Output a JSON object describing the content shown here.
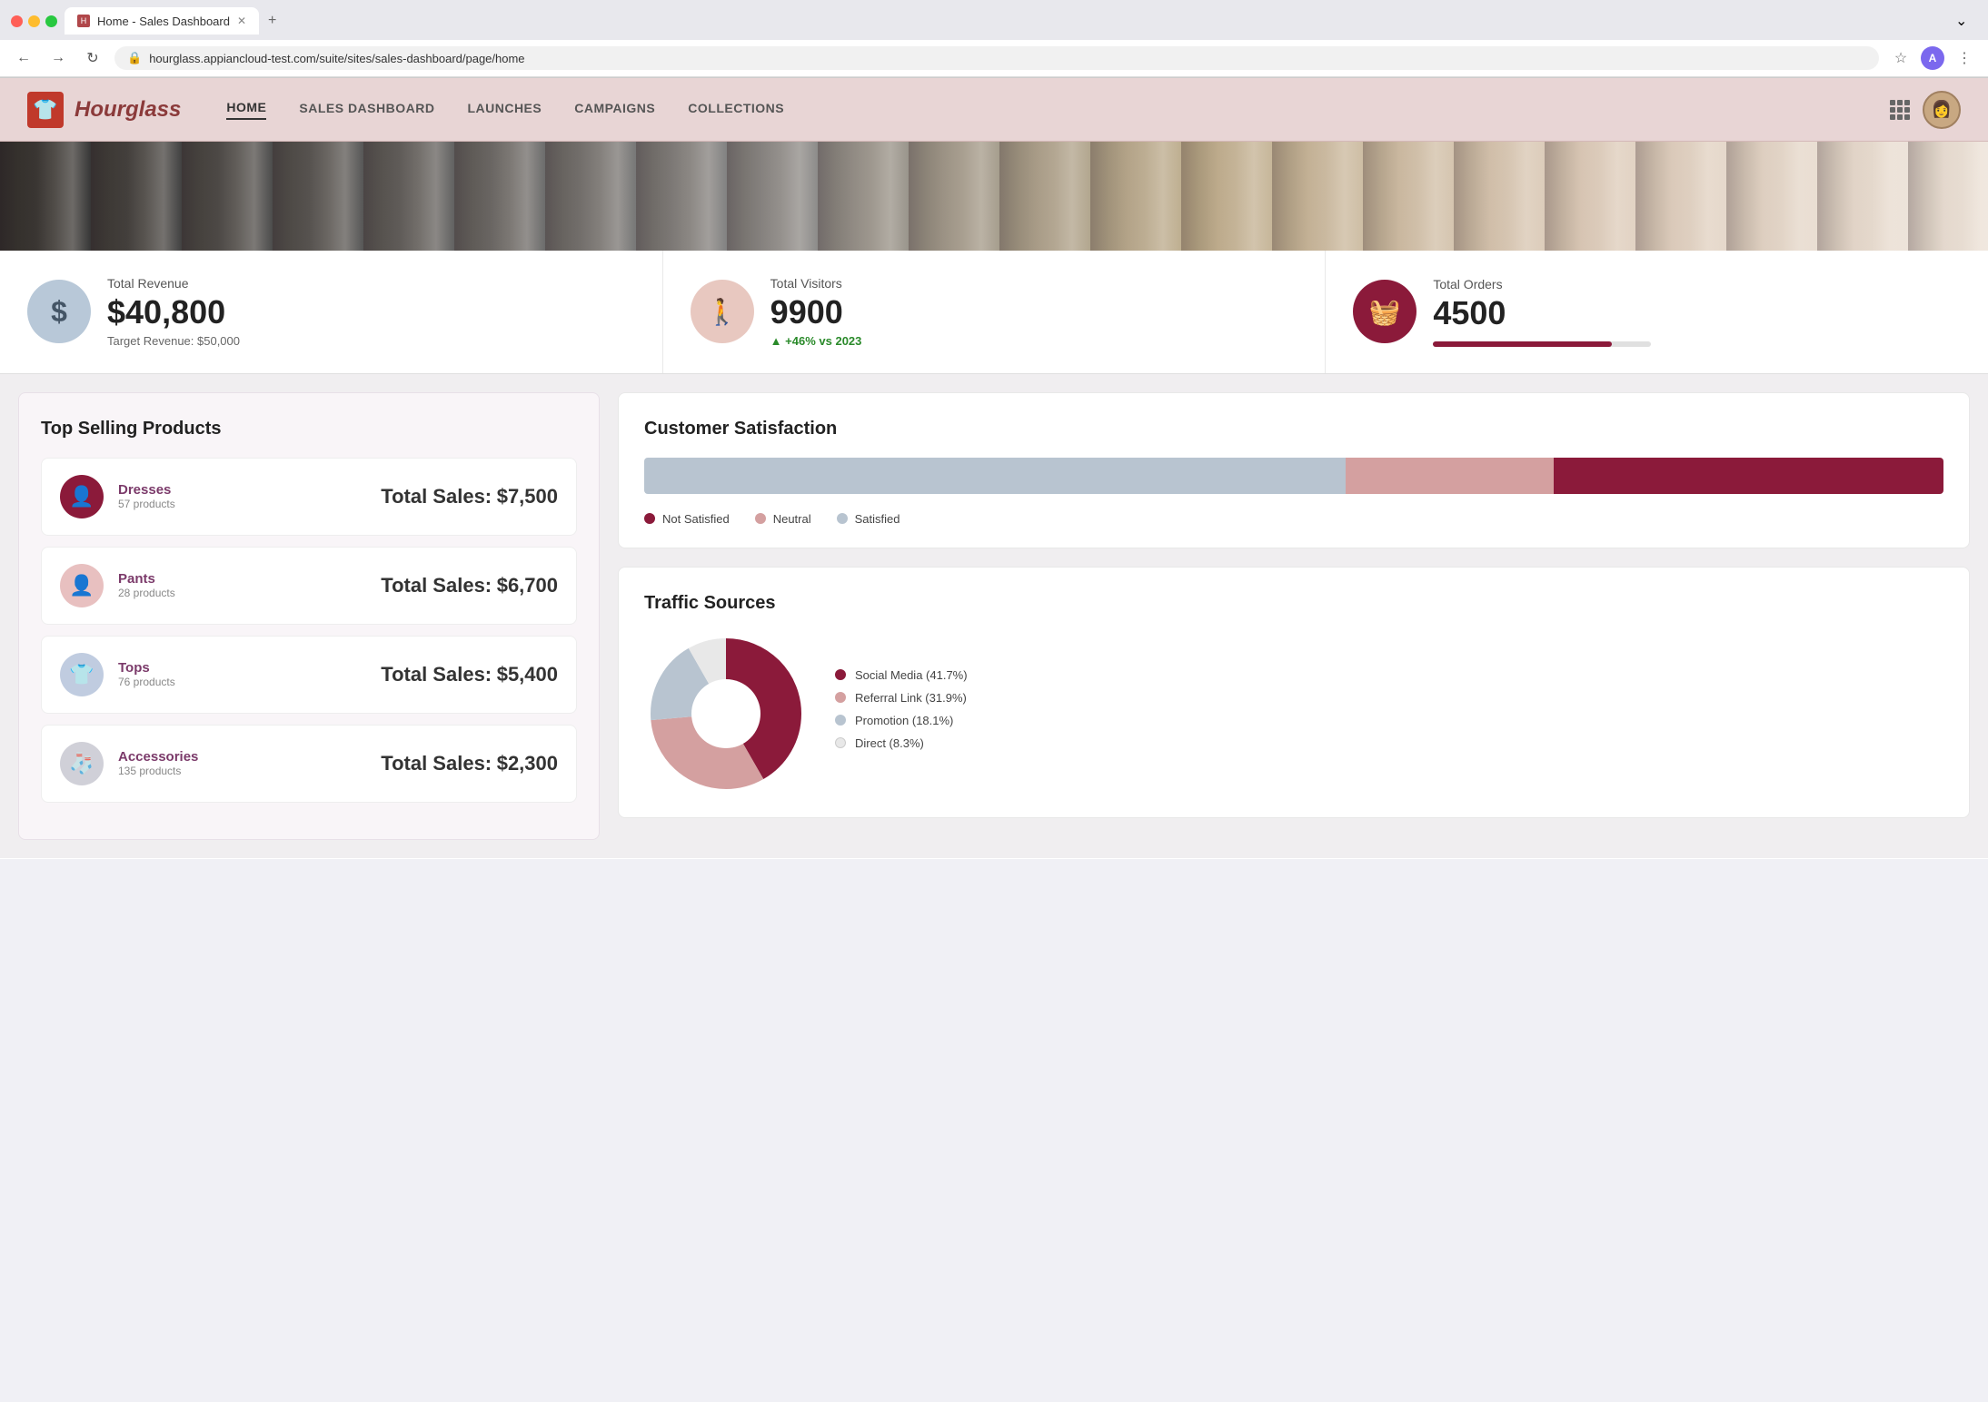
{
  "browser": {
    "tab_title": "Home - Sales Dashboard",
    "favicon_text": "H",
    "new_tab_icon": "+",
    "nav": {
      "back": "←",
      "forward": "→",
      "reload": "↻",
      "url": "hourglass.appiancloud-test.com/suite/sites/sales-dashboard/page/home",
      "bookmark": "☆",
      "profile_letter": "A",
      "more": "⋮"
    }
  },
  "app": {
    "brand_icon": "👕",
    "brand_name": "Hourglass",
    "nav_links": [
      {
        "label": "HOME",
        "active": true
      },
      {
        "label": "SALES DASHBOARD",
        "active": false
      },
      {
        "label": "LAUNCHES",
        "active": false
      },
      {
        "label": "CAMPAIGNS",
        "active": false
      },
      {
        "label": "COLLECTIONS",
        "active": false
      }
    ]
  },
  "stats": [
    {
      "icon": "$",
      "icon_class": "stat-icon-blue",
      "label": "Total Revenue",
      "value": "$40,800",
      "sub": "Target Revenue: $50,000",
      "sub_class": "",
      "show_progress": false
    },
    {
      "icon": "🚶",
      "icon_class": "stat-icon-pink",
      "label": "Total Visitors",
      "value": "9900",
      "sub": "+46% vs 2023",
      "sub_class": "stat-sub-green",
      "show_progress": false
    },
    {
      "icon": "🧺",
      "icon_class": "stat-icon-dark",
      "label": "Total Orders",
      "value": "4500",
      "sub": "",
      "sub_class": "",
      "show_progress": true,
      "progress": 82
    }
  ],
  "top_selling": {
    "title": "Top Selling Products",
    "products": [
      {
        "name": "Dresses",
        "count": "57 products",
        "sales_label": "Total Sales:",
        "sales_value": "$7,500",
        "icon": "👤",
        "icon_class": "product-icon-dark"
      },
      {
        "name": "Pants",
        "count": "28 products",
        "sales_label": "Total Sales:",
        "sales_value": "$6,700",
        "icon": "👤",
        "icon_class": "product-icon-pink"
      },
      {
        "name": "Tops",
        "count": "76 products",
        "sales_label": "Total Sales:",
        "sales_value": "$5,400",
        "icon": "👕",
        "icon_class": "product-icon-blue"
      },
      {
        "name": "Accessories",
        "count": "135 products",
        "sales_label": "Total Sales:",
        "sales_value": "$2,300",
        "icon": "🧦",
        "icon_class": "product-icon-gray"
      }
    ]
  },
  "satisfaction": {
    "title": "Customer Satisfaction",
    "segments": [
      {
        "label": "Not Satisfied",
        "width_pct": 54,
        "class": "sat-segment-gray"
      },
      {
        "label": "Neutral",
        "width_pct": 16,
        "class": "sat-segment-pink"
      },
      {
        "label": "Satisfied",
        "width_pct": 30,
        "class": "sat-segment-dark"
      }
    ],
    "legend": [
      {
        "label": "Not Satisfied",
        "dot_class": "legend-dark"
      },
      {
        "label": "Neutral",
        "dot_class": "legend-pink"
      },
      {
        "label": "Satisfied",
        "dot_class": "legend-gray"
      }
    ]
  },
  "traffic": {
    "title": "Traffic Sources",
    "legend": [
      {
        "label": "Social Media (41.7%)",
        "dot_class": "tl-dark"
      },
      {
        "label": "Referral Link (31.9%)",
        "dot_class": "tl-pink"
      },
      {
        "label": "Promotion (18.1%)",
        "dot_class": "tl-light"
      },
      {
        "label": "Direct (8.3%)",
        "dot_class": "tl-white"
      }
    ],
    "donut": {
      "segments": [
        {
          "pct": 41.7,
          "color": "#8b1a3a"
        },
        {
          "pct": 31.9,
          "color": "#d4a0a0"
        },
        {
          "pct": 18.1,
          "color": "#b8c4d0"
        },
        {
          "pct": 8.3,
          "color": "#e8e8e8"
        }
      ]
    }
  }
}
